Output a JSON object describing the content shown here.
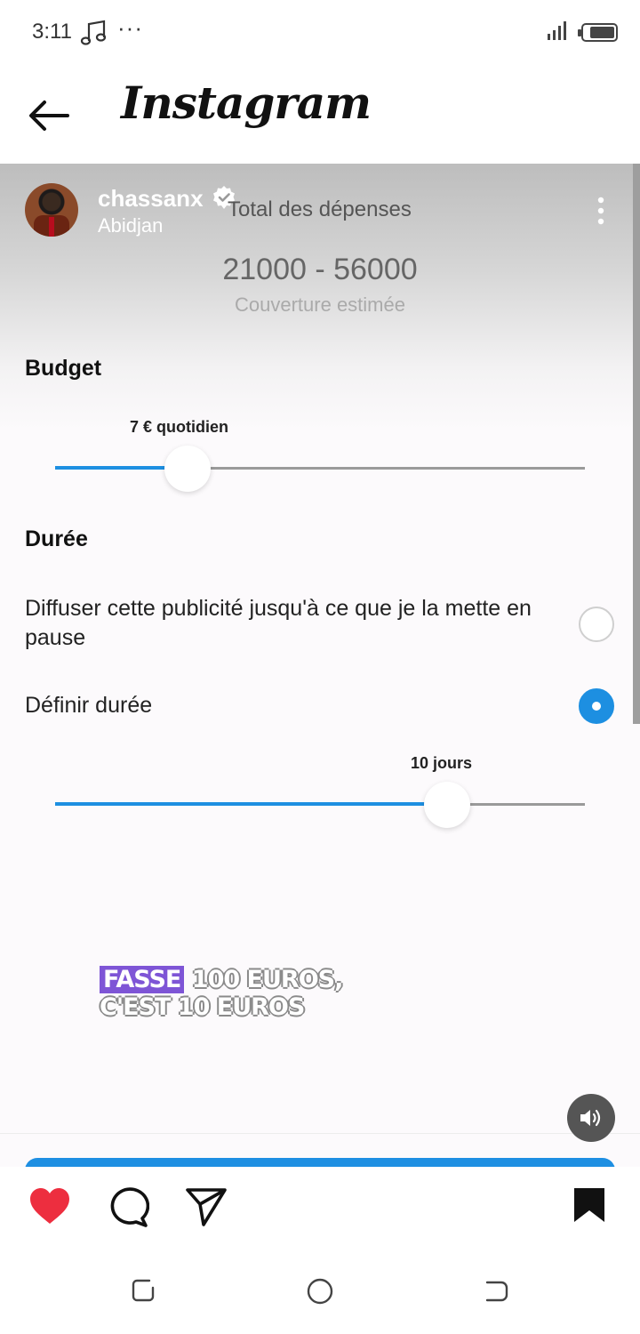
{
  "status_bar": {
    "time": "3:11",
    "more": "···"
  },
  "header": {
    "title": "Instagram"
  },
  "post": {
    "username": "chassanx",
    "location": "Abidjan",
    "overlay": {
      "total_label": "Total des dépenses",
      "reach_range": "21000 - 56000",
      "reach_caption": "Couverture estimée",
      "budget": {
        "title": "Budget",
        "slider_label": "7 € quotidien",
        "slider_fraction": 0.25
      },
      "duration": {
        "title": "Durée",
        "option_continuous": "Diffuser cette publicité jusqu'à ce que je la mette en pause",
        "option_continuous_selected": false,
        "option_fixed": "Définir durée",
        "option_fixed_selected": true,
        "slider_label": "10 jours",
        "slider_fraction": 0.74
      }
    },
    "caption": {
      "line1_highlight": "FASSE",
      "line1_rest": "100 EUROS,",
      "line2": "C'EST 10 EUROS"
    }
  },
  "actions": [
    "heart-icon",
    "comment-icon",
    "share-icon",
    "bookmark-icon"
  ],
  "colors": {
    "accent": "#1d8fe1",
    "like": "#ed2e3f",
    "caption_highlight": "#7e55d6"
  }
}
